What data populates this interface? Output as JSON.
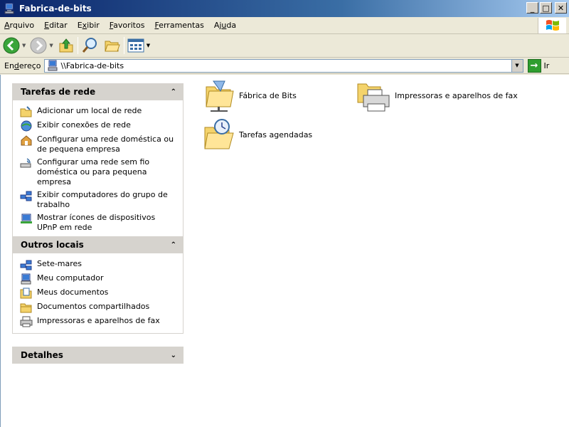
{
  "window": {
    "title": "Fabrica-de-bits"
  },
  "menu": [
    {
      "pre": "",
      "u": "A",
      "post": "rquivo"
    },
    {
      "pre": "",
      "u": "E",
      "post": "ditar"
    },
    {
      "pre": "E",
      "u": "x",
      "post": "ibir"
    },
    {
      "pre": "",
      "u": "F",
      "post": "avoritos"
    },
    {
      "pre": "",
      "u": "F",
      "post": "erramentas"
    },
    {
      "pre": "Aj",
      "u": "u",
      "post": "da"
    }
  ],
  "address": {
    "label_pre": "En",
    "label_u": "d",
    "label_post": "ereço",
    "value": "\\\\Fabrica-de-bits",
    "go_label": "Ir"
  },
  "panels": {
    "network_tasks": {
      "title": "Tarefas de rede",
      "items": [
        "Adicionar um local de rede",
        "Exibir conexões de rede",
        "Configurar uma rede doméstica ou de pequena empresa",
        "Configurar uma rede sem fio doméstica ou para pequena empresa",
        "Exibir computadores do grupo de trabalho",
        "Mostrar ícones de dispositivos UPnP em rede"
      ]
    },
    "other_places": {
      "title": "Outros locais",
      "items": [
        "Sete-mares",
        "Meu computador",
        "Meus documentos",
        "Documentos compartilhados",
        "Impressoras e aparelhos de fax"
      ]
    },
    "details": {
      "title": "Detalhes"
    }
  },
  "content_items": [
    "Fábrica de Bits",
    "Impressoras e aparelhos de fax",
    "Tarefas agendadas"
  ]
}
